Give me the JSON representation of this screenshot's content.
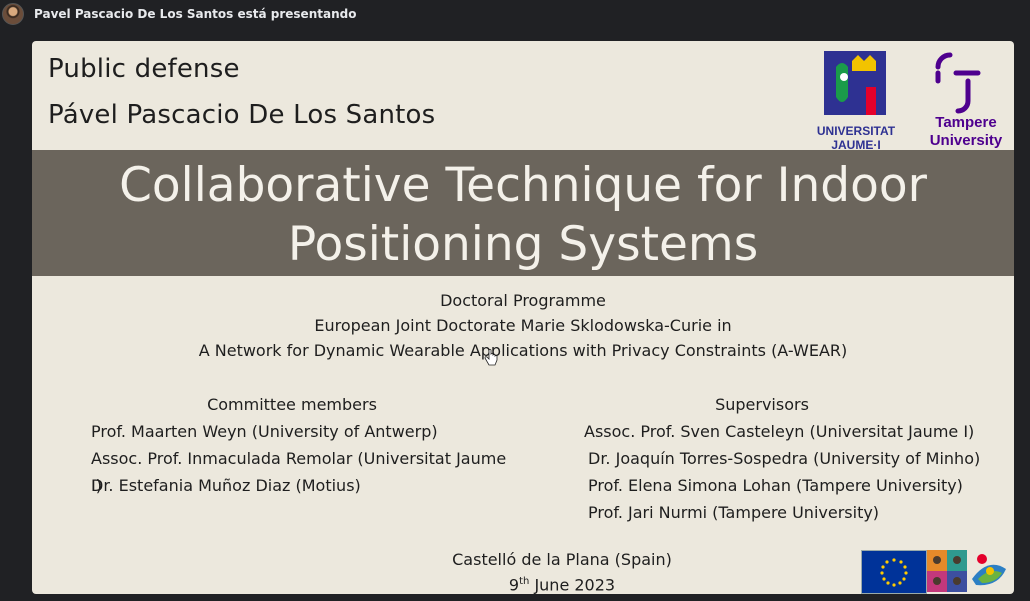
{
  "topbar": {
    "presenter_text": "Pavel Pascacio De Los Santos está presentando"
  },
  "slide": {
    "header_line1": "Public defense",
    "header_line2": "Pável Pascacio De Los Santos",
    "title_line1": "Collaborative Technique for Indoor",
    "title_line2": "Positioning Systems",
    "programme": {
      "heading": "Doctoral Programme",
      "line1": "European Joint Doctorate Marie Sklodowska-Curie in",
      "line2": "A Network for Dynamic Wearable Applications with Privacy Constraints (A-WEAR)"
    },
    "committee": {
      "heading": "Committee members",
      "members": [
        "Prof. Maarten Weyn (University of Antwerp)",
        "Assoc. Prof. Inmaculada Remolar (Universitat Jaume I)",
        "Dr. Estefania Muñoz Diaz (Motius)"
      ]
    },
    "supervisors": {
      "heading": "Supervisors",
      "members": [
        "Assoc. Prof. Sven Casteleyn (Universitat Jaume I)",
        "Dr. Joaquín Torres-Sospedra (University of Minho)",
        "Prof. Elena Simona Lohan (Tampere University)",
        "Prof. Jari Nurmi (Tampere University)"
      ]
    },
    "place": "Castelló de la Plana (Spain)",
    "date_day": "9",
    "date_suffix": "th",
    "date_rest": " June 2023",
    "logos": {
      "uji_line1": "UNIVERSITAT",
      "uji_line2": "JAUME·I",
      "tampere_line1": "Tampere",
      "tampere_line2": "University"
    }
  },
  "colors": {
    "band": "#6b655c",
    "slide_bg": "#ece8dd",
    "uji_blue": "#2e3192",
    "tampere_purple": "#4e008e",
    "eu_blue": "#003399"
  }
}
